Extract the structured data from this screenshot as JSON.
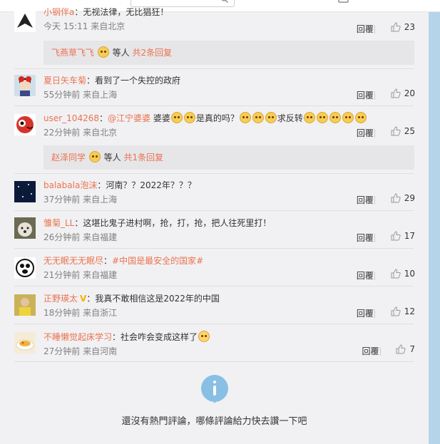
{
  "colors": {
    "username": "#eb7350",
    "page_bg": "#f1f1f3",
    "accent": "#89bfe4"
  },
  "comments": [
    {
      "user": "小钢伴a",
      "text": "：无视法律，无比猖狂！",
      "time": "今天 15:11 来自北京",
      "reply": "回覆",
      "likes": "23",
      "avatar_icon": "black-triangle-logo-avatar"
    },
    {
      "user": "夏日矢车菊",
      "text": "：看到了一个失控的政府",
      "time": "55分钟前 来自上海",
      "reply": "回覆",
      "likes": "20",
      "avatar_icon": "anime-girl-avatar"
    },
    {
      "user": "user_104268",
      "mention": "@江宁婆婆",
      "text_a": " 婆婆",
      "text_b": "是真的吗？",
      "text_c": "求反转",
      "time": "22分钟前 来自北京",
      "reply": "回覆",
      "likes": "25",
      "avatar_icon": "red-cartoon-avatar"
    },
    {
      "user": "balabala泡沫",
      "text": "：河南？？2022年？？？",
      "time": "37分钟前 来自上海",
      "reply": "回覆",
      "likes": "29",
      "avatar_icon": "night-sky-avatar"
    },
    {
      "user": "雏菊_LL",
      "text": "：这堪比鬼子进村啊，抢，打，抢，把人往死里打！",
      "time": "26分钟前 来自福建",
      "reply": "回覆",
      "likes": "17",
      "avatar_icon": "dog-avatar"
    },
    {
      "user": "无无眠无无眠尽",
      "text": "：",
      "hashtag": "#中国是最安全的国家#",
      "time": "21分钟前 来自福建",
      "reply": "回覆",
      "likes": "10",
      "avatar_icon": "cartoon-face-avatar"
    },
    {
      "user": "正野瑛太",
      "vip": "V",
      "text": "：我真不敢相信这是2022年的中国",
      "time": "18分钟前 来自浙江",
      "reply": "回覆",
      "likes": "12",
      "avatar_icon": "person-yellow-avatar"
    },
    {
      "user": "不睡懒觉起床学习",
      "text": "：社会咋会变成这样了",
      "time": "27分钟前 来自河南",
      "reply": "回覆",
      "likes": "7",
      "avatar_icon": "food-plate-avatar"
    }
  ],
  "sub_replies": [
    {
      "user": "飞燕草飞飞",
      "middle": " 等人 ",
      "more": "共2条回复"
    },
    {
      "user": "赵泽同学",
      "middle": " 等人 ",
      "more": "共1条回复"
    }
  ],
  "footer": {
    "text": "還沒有熱門評論，哪條評論給力快去讚一下吧",
    "icon": "info-icon"
  }
}
